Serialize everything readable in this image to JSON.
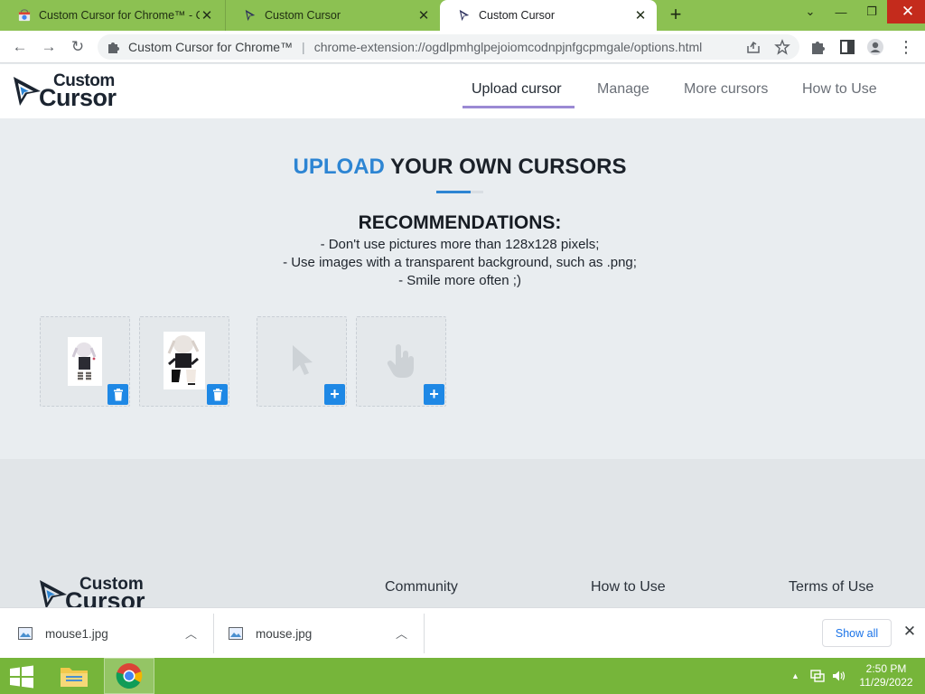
{
  "browser": {
    "tabs": [
      {
        "title": "Custom Cursor for Chrome™ - C",
        "icon": "chrome-webstore-icon",
        "active": false
      },
      {
        "title": "Custom Cursor",
        "icon": "custom-cursor-favicon",
        "active": false
      },
      {
        "title": "Custom Cursor",
        "icon": "custom-cursor-favicon",
        "active": true
      }
    ],
    "omnibox": {
      "extension_name": "Custom Cursor for Chrome™",
      "url": "chrome-extension://ogdlpmhglpejoiomcodnpjnfgcpmgale/options.html"
    }
  },
  "site": {
    "logo": {
      "line1": "Custom",
      "line2": "Cursor"
    },
    "nav": [
      {
        "label": "Upload cursor",
        "active": true
      },
      {
        "label": "Manage",
        "active": false
      },
      {
        "label": "More cursors",
        "active": false
      },
      {
        "label": "How to Use",
        "active": false
      }
    ]
  },
  "main": {
    "headline_highlight": "UPLOAD",
    "headline_rest": "YOUR OWN CURSORS",
    "recommendations_title": "RECOMMENDATIONS:",
    "recommendations": [
      "- Don't use pictures more than 128x128 pixels;",
      "- Use images with a transparent background, such as .png;",
      "- Smile more often ;)"
    ],
    "slots": [
      {
        "kind": "uploaded",
        "action": "delete",
        "icon": "trash-icon"
      },
      {
        "kind": "uploaded",
        "action": "delete",
        "icon": "trash-icon"
      },
      {
        "kind": "empty-pointer",
        "action": "add",
        "icon": "plus-icon"
      },
      {
        "kind": "empty-hand",
        "action": "add",
        "icon": "plus-icon"
      }
    ],
    "slot_button_plus": "+"
  },
  "footer": {
    "logo": {
      "line1": "Custom",
      "line2": "Cursor"
    },
    "links": [
      "Community",
      "How to Use",
      "Terms of Use"
    ]
  },
  "downloads": {
    "items": [
      {
        "filename": "mouse1.jpg"
      },
      {
        "filename": "mouse.jpg"
      }
    ],
    "show_all": "Show all"
  },
  "taskbar": {
    "time": "2:50 PM",
    "date": "11/29/2022"
  },
  "colors": {
    "accent": "#2d85d3",
    "nav_underline": "#9b8ad4",
    "tabstrip": "#8cc152",
    "taskbar": "#76b53a",
    "slot_button": "#1e88e5"
  }
}
